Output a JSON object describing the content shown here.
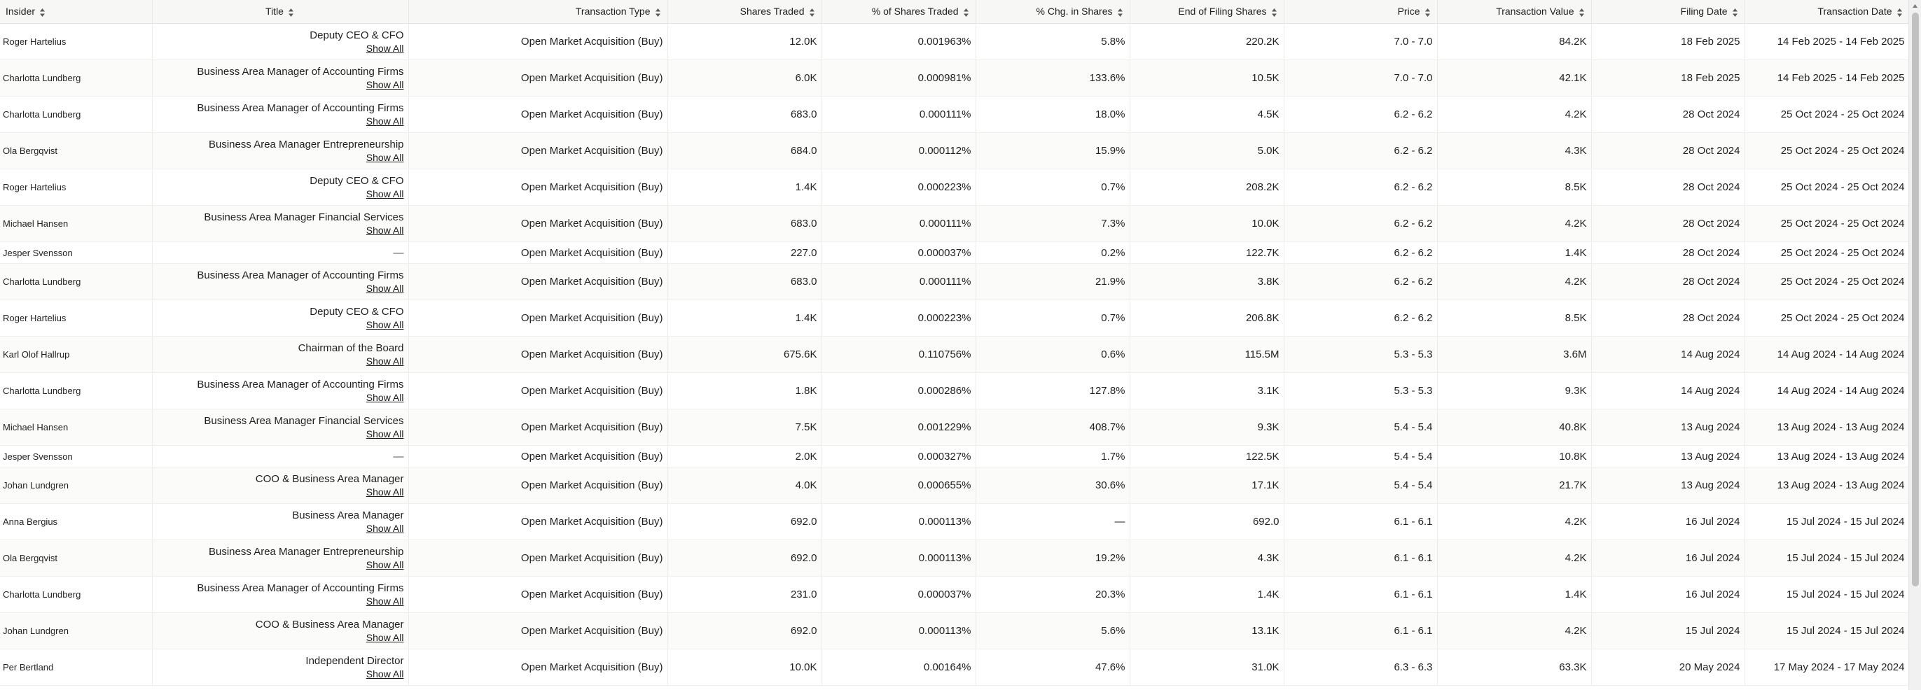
{
  "columns": {
    "insider": "Insider",
    "title": "Title",
    "transaction_type": "Transaction Type",
    "shares_traded": "Shares Traded",
    "pct_shares_traded": "% of Shares Traded",
    "pct_chg_shares": "% Chg. in Shares",
    "end_of_filing_shares": "End of Filing Shares",
    "price": "Price",
    "transaction_value": "Transaction Value",
    "filing_date": "Filing Date",
    "transaction_date": "Transaction Date"
  },
  "show_all_label": "Show All",
  "rows": [
    {
      "insider": "Roger Hartelius",
      "title": "Deputy CEO & CFO",
      "type": "Open Market Acquisition (Buy)",
      "shares": "12.0K",
      "pct": "0.001963%",
      "chg": "5.8%",
      "end": "220.2K",
      "price": "7.0 - 7.0",
      "value": "84.2K",
      "filing": "18 Feb 2025",
      "tdate": "14 Feb 2025 - 14 Feb 2025"
    },
    {
      "insider": "Charlotta Lundberg",
      "title": "Business Area Manager of Accounting Firms",
      "type": "Open Market Acquisition (Buy)",
      "shares": "6.0K",
      "pct": "0.000981%",
      "chg": "133.6%",
      "end": "10.5K",
      "price": "7.0 - 7.0",
      "value": "42.1K",
      "filing": "18 Feb 2025",
      "tdate": "14 Feb 2025 - 14 Feb 2025"
    },
    {
      "insider": "Charlotta Lundberg",
      "title": "Business Area Manager of Accounting Firms",
      "type": "Open Market Acquisition (Buy)",
      "shares": "683.0",
      "pct": "0.000111%",
      "chg": "18.0%",
      "end": "4.5K",
      "price": "6.2 - 6.2",
      "value": "4.2K",
      "filing": "28 Oct 2024",
      "tdate": "25 Oct 2024 - 25 Oct 2024"
    },
    {
      "insider": "Ola Bergqvist",
      "title": "Business Area Manager Entrepreneurship",
      "type": "Open Market Acquisition (Buy)",
      "shares": "684.0",
      "pct": "0.000112%",
      "chg": "15.9%",
      "end": "5.0K",
      "price": "6.2 - 6.2",
      "value": "4.3K",
      "filing": "28 Oct 2024",
      "tdate": "25 Oct 2024 - 25 Oct 2024"
    },
    {
      "insider": "Roger Hartelius",
      "title": "Deputy CEO & CFO",
      "type": "Open Market Acquisition (Buy)",
      "shares": "1.4K",
      "pct": "0.000223%",
      "chg": "0.7%",
      "end": "208.2K",
      "price": "6.2 - 6.2",
      "value": "8.5K",
      "filing": "28 Oct 2024",
      "tdate": "25 Oct 2024 - 25 Oct 2024"
    },
    {
      "insider": "Michael Hansen",
      "title": "Business Area Manager Financial Services",
      "type": "Open Market Acquisition (Buy)",
      "shares": "683.0",
      "pct": "0.000111%",
      "chg": "7.3%",
      "end": "10.0K",
      "price": "6.2 - 6.2",
      "value": "4.2K",
      "filing": "28 Oct 2024",
      "tdate": "25 Oct 2024 - 25 Oct 2024"
    },
    {
      "insider": "Jesper Svensson",
      "title": "—",
      "type": "Open Market Acquisition (Buy)",
      "shares": "227.0",
      "pct": "0.000037%",
      "chg": "0.2%",
      "end": "122.7K",
      "price": "6.2 - 6.2",
      "value": "1.4K",
      "filing": "28 Oct 2024",
      "tdate": "25 Oct 2024 - 25 Oct 2024"
    },
    {
      "insider": "Charlotta Lundberg",
      "title": "Business Area Manager of Accounting Firms",
      "type": "Open Market Acquisition (Buy)",
      "shares": "683.0",
      "pct": "0.000111%",
      "chg": "21.9%",
      "end": "3.8K",
      "price": "6.2 - 6.2",
      "value": "4.2K",
      "filing": "28 Oct 2024",
      "tdate": "25 Oct 2024 - 25 Oct 2024"
    },
    {
      "insider": "Roger Hartelius",
      "title": "Deputy CEO & CFO",
      "type": "Open Market Acquisition (Buy)",
      "shares": "1.4K",
      "pct": "0.000223%",
      "chg": "0.7%",
      "end": "206.8K",
      "price": "6.2 - 6.2",
      "value": "8.5K",
      "filing": "28 Oct 2024",
      "tdate": "25 Oct 2024 - 25 Oct 2024"
    },
    {
      "insider": "Karl Olof Hallrup",
      "title": "Chairman of the Board",
      "type": "Open Market Acquisition (Buy)",
      "shares": "675.6K",
      "pct": "0.110756%",
      "chg": "0.6%",
      "end": "115.5M",
      "price": "5.3 - 5.3",
      "value": "3.6M",
      "filing": "14 Aug 2024",
      "tdate": "14 Aug 2024 - 14 Aug 2024"
    },
    {
      "insider": "Charlotta Lundberg",
      "title": "Business Area Manager of Accounting Firms",
      "type": "Open Market Acquisition (Buy)",
      "shares": "1.8K",
      "pct": "0.000286%",
      "chg": "127.8%",
      "end": "3.1K",
      "price": "5.3 - 5.3",
      "value": "9.3K",
      "filing": "14 Aug 2024",
      "tdate": "14 Aug 2024 - 14 Aug 2024"
    },
    {
      "insider": "Michael Hansen",
      "title": "Business Area Manager Financial Services",
      "type": "Open Market Acquisition (Buy)",
      "shares": "7.5K",
      "pct": "0.001229%",
      "chg": "408.7%",
      "end": "9.3K",
      "price": "5.4 - 5.4",
      "value": "40.8K",
      "filing": "13 Aug 2024",
      "tdate": "13 Aug 2024 - 13 Aug 2024"
    },
    {
      "insider": "Jesper Svensson",
      "title": "—",
      "type": "Open Market Acquisition (Buy)",
      "shares": "2.0K",
      "pct": "0.000327%",
      "chg": "1.7%",
      "end": "122.5K",
      "price": "5.4 - 5.4",
      "value": "10.8K",
      "filing": "13 Aug 2024",
      "tdate": "13 Aug 2024 - 13 Aug 2024"
    },
    {
      "insider": "Johan Lundgren",
      "title": "COO & Business Area Manager",
      "type": "Open Market Acquisition (Buy)",
      "shares": "4.0K",
      "pct": "0.000655%",
      "chg": "30.6%",
      "end": "17.1K",
      "price": "5.4 - 5.4",
      "value": "21.7K",
      "filing": "13 Aug 2024",
      "tdate": "13 Aug 2024 - 13 Aug 2024"
    },
    {
      "insider": "Anna Bergius",
      "title": "Business Area Manager",
      "type": "Open Market Acquisition (Buy)",
      "shares": "692.0",
      "pct": "0.000113%",
      "chg": "—",
      "end": "692.0",
      "price": "6.1 - 6.1",
      "value": "4.2K",
      "filing": "16 Jul 2024",
      "tdate": "15 Jul 2024 - 15 Jul 2024"
    },
    {
      "insider": "Ola Bergqvist",
      "title": "Business Area Manager Entrepreneurship",
      "type": "Open Market Acquisition (Buy)",
      "shares": "692.0",
      "pct": "0.000113%",
      "chg": "19.2%",
      "end": "4.3K",
      "price": "6.1 - 6.1",
      "value": "4.2K",
      "filing": "16 Jul 2024",
      "tdate": "15 Jul 2024 - 15 Jul 2024"
    },
    {
      "insider": "Charlotta Lundberg",
      "title": "Business Area Manager of Accounting Firms",
      "type": "Open Market Acquisition (Buy)",
      "shares": "231.0",
      "pct": "0.000037%",
      "chg": "20.3%",
      "end": "1.4K",
      "price": "6.1 - 6.1",
      "value": "1.4K",
      "filing": "16 Jul 2024",
      "tdate": "15 Jul 2024 - 15 Jul 2024"
    },
    {
      "insider": "Johan Lundgren",
      "title": "COO & Business Area Manager",
      "type": "Open Market Acquisition (Buy)",
      "shares": "692.0",
      "pct": "0.000113%",
      "chg": "5.6%",
      "end": "13.1K",
      "price": "6.1 - 6.1",
      "value": "4.2K",
      "filing": "15 Jul 2024",
      "tdate": "15 Jul 2024 - 15 Jul 2024"
    },
    {
      "insider": "Per Bertland",
      "title": "Independent Director",
      "type": "Open Market Acquisition (Buy)",
      "shares": "10.0K",
      "pct": "0.00164%",
      "chg": "47.6%",
      "end": "31.0K",
      "price": "6.3 - 6.3",
      "value": "63.3K",
      "filing": "20 May 2024",
      "tdate": "17 May 2024 - 17 May 2024"
    }
  ]
}
